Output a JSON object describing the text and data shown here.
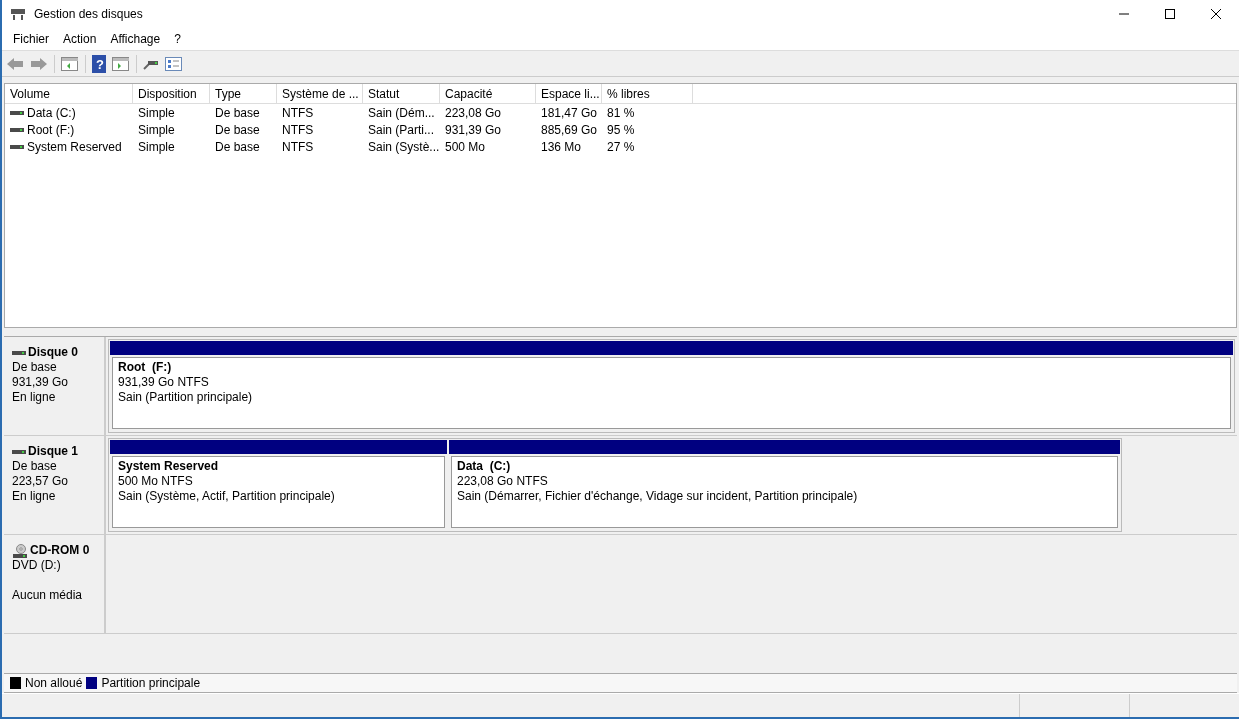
{
  "window": {
    "title": "Gestion des disques"
  },
  "menu": [
    "Fichier",
    "Action",
    "Affichage",
    "?"
  ],
  "table": {
    "columns": [
      "Volume",
      "Disposition",
      "Type",
      "Système de ...",
      "Statut",
      "Capacité",
      "Espace li...",
      "% libres"
    ],
    "rows": [
      [
        "Data (C:)",
        "Simple",
        "De base",
        "NTFS",
        "Sain (Dém...",
        "223,08 Go",
        "181,47 Go",
        "81 %"
      ],
      [
        "Root (F:)",
        "Simple",
        "De base",
        "NTFS",
        "Sain (Parti...",
        "931,39 Go",
        "885,69 Go",
        "95 %"
      ],
      [
        "System Reserved",
        "Simple",
        "De base",
        "NTFS",
        "Sain (Systè...",
        "500 Mo",
        "136 Mo",
        "27 %"
      ]
    ]
  },
  "disks": [
    {
      "kind": "disk",
      "name": "Disque 0",
      "lines": [
        "De base",
        "931,39 Go",
        "En ligne"
      ],
      "partitions": [
        {
          "name": "Root  (F:)",
          "size": "931,39 Go NTFS",
          "status": "Sain (Partition principale)"
        }
      ]
    },
    {
      "kind": "disk",
      "name": "Disque 1",
      "lines": [
        "De base",
        "223,57 Go",
        "En ligne"
      ],
      "partitions": [
        {
          "name": "System Reserved",
          "size": "500 Mo NTFS",
          "status": "Sain (Système, Actif, Partition principale)"
        },
        {
          "name": "Data  (C:)",
          "size": "223,08 Go NTFS",
          "status": "Sain (Démarrer, Fichier d'échange, Vidage sur incident, Partition principale)"
        }
      ]
    },
    {
      "kind": "cdrom",
      "name": "CD-ROM 0",
      "lines": [
        "DVD (D:)",
        "Aucun média"
      ]
    }
  ],
  "toolbar": {
    "help_glyph": "?"
  },
  "legend": [
    {
      "label": "Non alloué",
      "color": "#000000"
    },
    {
      "label": "Partition principale",
      "color": "#000080"
    }
  ]
}
